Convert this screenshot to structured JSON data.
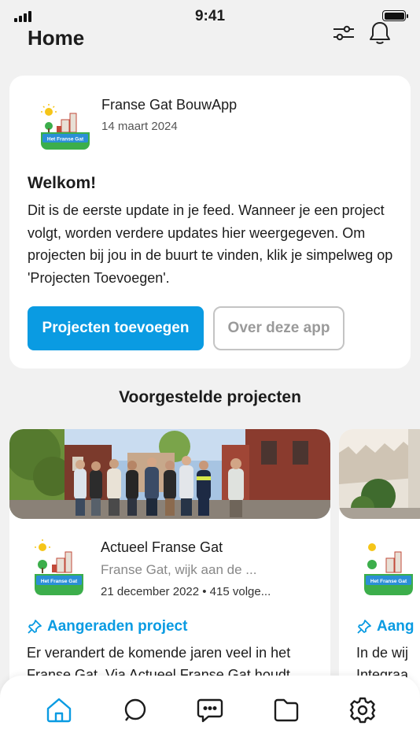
{
  "status": {
    "time": "9:41"
  },
  "header": {
    "title": "Home",
    "filter_icon": "sliders-icon",
    "bell_icon": "bell-icon"
  },
  "welcome_card": {
    "source_name": "Franse Gat BouwApp",
    "date": "14 maart 2024",
    "logo_label": "Het Franse Gat",
    "title": "Welkom!",
    "body": "Dit is de eerste update in je feed. Wanneer je een project volgt, worden verdere updates hier weergegeven. Om projecten bij jou in de buurt te vinden, klik je simpelweg op 'Projecten Toevoegen'.",
    "primary_button": "Projecten toevoegen",
    "secondary_button": "Over deze app"
  },
  "suggested": {
    "title": "Voorgestelde projecten",
    "projects": [
      {
        "name": "Actueel Franse Gat",
        "location": "Franse Gat, wijk aan de ...",
        "meta": "21 december 2022 • 415 volge...",
        "logo_label": "Het Franse Gat",
        "tag": "Aangeraden project",
        "description": "Er verandert de komende jaren veel in het Franse Gat. Via Actueel Franse Gat houdt"
      },
      {
        "name": "",
        "location": "",
        "meta": "",
        "logo_label": "Het Franse Gat",
        "tag": "Aang",
        "description": "In de wij Integraa"
      }
    ]
  },
  "tabbar": {
    "items": [
      "home-icon",
      "search-icon",
      "chat-icon",
      "folder-icon",
      "gear-icon"
    ],
    "active_color": "#0a9be2"
  },
  "colors": {
    "accent": "#0a9be2",
    "background": "#f1f1f1"
  }
}
